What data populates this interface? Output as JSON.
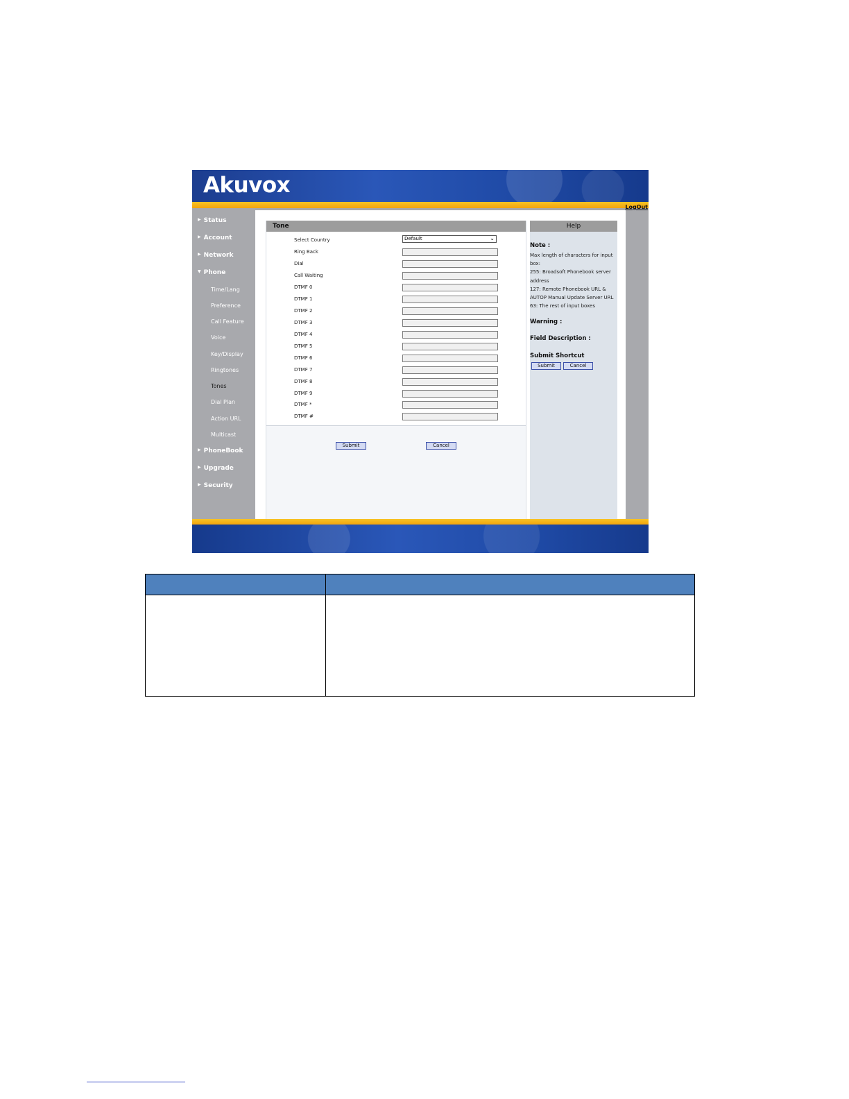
{
  "app": {
    "logo": "Akuvox",
    "logout": "LogOut"
  },
  "sidebar": {
    "items": [
      {
        "label": "Status"
      },
      {
        "label": "Account"
      },
      {
        "label": "Network"
      },
      {
        "label": "Phone"
      },
      {
        "label": "PhoneBook"
      },
      {
        "label": "Upgrade"
      },
      {
        "label": "Security"
      }
    ],
    "phone_sub": [
      {
        "label": "Time/Lang"
      },
      {
        "label": "Preference"
      },
      {
        "label": "Call Feature"
      },
      {
        "label": "Voice"
      },
      {
        "label": "Key/Display"
      },
      {
        "label": "Ringtones"
      },
      {
        "label": "Tones"
      },
      {
        "label": "Dial Plan"
      },
      {
        "label": "Action URL"
      },
      {
        "label": "Multicast"
      }
    ]
  },
  "panel": {
    "title": "Tone",
    "select_country_label": "Select Country",
    "select_country_value": "Default",
    "fields": [
      {
        "label": "Ring Back",
        "value": ""
      },
      {
        "label": "Dial",
        "value": ""
      },
      {
        "label": "Call Waiting",
        "value": ""
      },
      {
        "label": "DTMF 0",
        "value": ""
      },
      {
        "label": "DTMF 1",
        "value": ""
      },
      {
        "label": "DTMF 2",
        "value": ""
      },
      {
        "label": "DTMF 3",
        "value": ""
      },
      {
        "label": "DTMF 4",
        "value": ""
      },
      {
        "label": "DTMF 5",
        "value": ""
      },
      {
        "label": "DTMF 6",
        "value": ""
      },
      {
        "label": "DTMF 7",
        "value": ""
      },
      {
        "label": "DTMF 8",
        "value": ""
      },
      {
        "label": "DTMF 9",
        "value": ""
      },
      {
        "label": "DTMF *",
        "value": ""
      },
      {
        "label": "DTMF #",
        "value": ""
      }
    ],
    "submit": "Submit",
    "cancel": "Cancel"
  },
  "help": {
    "title": "Help",
    "note_title": "Note :",
    "note_lines": [
      "Max length of characters for input box:",
      "255: Broadsoft Phonebook server address",
      "127: Remote Phonebook URL & AUTOP Manual Update Server URL",
      "63: The rest of input boxes"
    ],
    "warning_title": "Warning :",
    "field_desc_title": "Field Description :",
    "shortcut_title": "Submit Shortcut",
    "submit": "Submit",
    "cancel": "Cancel"
  },
  "colors": {
    "banner": "#1f4aa6",
    "gold": "#f3a40d",
    "sidebar": "#a8a9ad",
    "table_header": "#4f81bd",
    "button": "#d4dbf3"
  }
}
